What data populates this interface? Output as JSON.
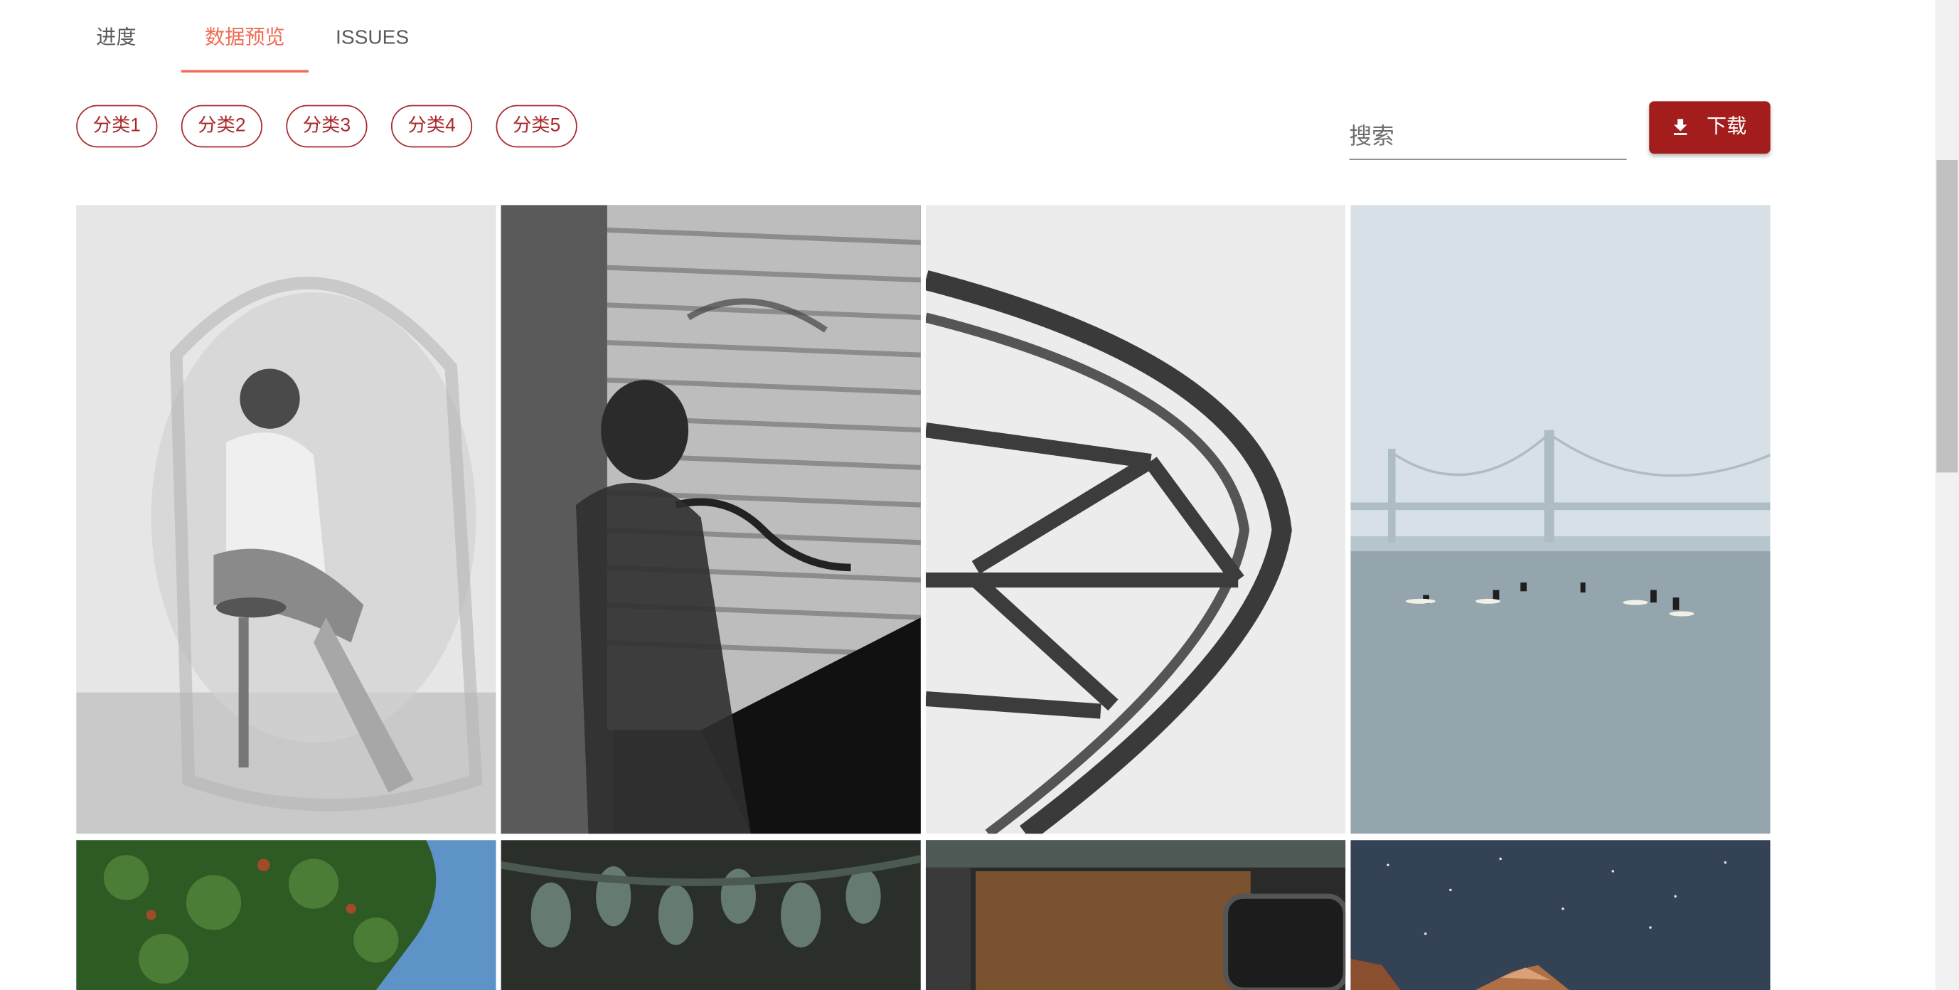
{
  "tabs": [
    {
      "label": "进度",
      "active": false
    },
    {
      "label": "数据预览",
      "active": true
    },
    {
      "label": "ISSUES",
      "active": false
    }
  ],
  "categories": [
    "分类1",
    "分类2",
    "分类3",
    "分类4",
    "分类5"
  ],
  "search": {
    "placeholder": "搜索",
    "value": ""
  },
  "download": {
    "label": "下载",
    "icon": "download-icon"
  },
  "gallery": {
    "images": [
      {
        "subject": "portrait-double-exposure"
      },
      {
        "subject": "graffiti-shutter-blurred-figure"
      },
      {
        "subject": "curved-steel-roof-structure"
      },
      {
        "subject": "foggy-bridge-with-surfers"
      },
      {
        "subject": "green-tree-blue-sky"
      },
      {
        "subject": "succulent-leaves"
      },
      {
        "subject": "car-interior-window"
      },
      {
        "subject": "night-sky-mountains"
      }
    ]
  },
  "colors": {
    "accent": "#ef6c55",
    "chip_border": "#a8282b",
    "download_bg": "#a31d1d"
  }
}
